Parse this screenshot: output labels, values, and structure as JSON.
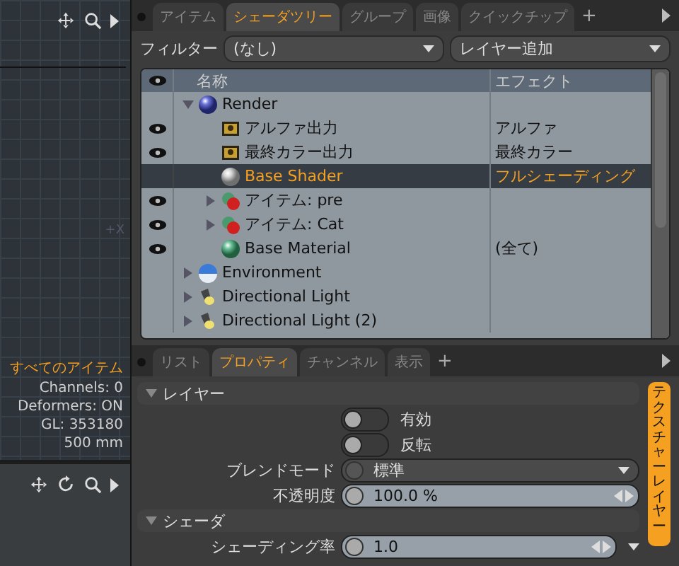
{
  "viewport_top": {
    "info": [
      {
        "text": "すべてのアイテム",
        "kind": "title"
      },
      {
        "text": "Channels: 0",
        "kind": "stat"
      },
      {
        "text": "Deformers: ON",
        "kind": "stat"
      },
      {
        "text": "GL: 353180",
        "kind": "stat"
      },
      {
        "text": "500 mm",
        "kind": "stat"
      }
    ],
    "axis_label": "+X"
  },
  "top_tab_add": "+",
  "bottom_tab_add": "+",
  "top_tabs": [
    {
      "label": "アイテム",
      "selected": false
    },
    {
      "label": "シェーダツリー",
      "selected": true
    },
    {
      "label": "グループ",
      "selected": false
    },
    {
      "label": "画像",
      "selected": false
    },
    {
      "label": "クイックチップ",
      "selected": false
    }
  ],
  "filter": {
    "label": "フィルター",
    "value": "(なし)",
    "add_layer": "レイヤー追加"
  },
  "tree": {
    "columns": [
      "名称",
      "エフェクト"
    ],
    "items": [
      {
        "name": "Render",
        "kind": "sphere-blue",
        "visible": false,
        "selected": false,
        "expanded": true,
        "children": [
          {
            "name": "アルファ出力",
            "kind": "image",
            "visible": true,
            "selected": false,
            "effect": "アルファ"
          },
          {
            "name": "最終カラー出力",
            "kind": "image",
            "visible": true,
            "selected": false,
            "effect": "最終カラー"
          },
          {
            "name": "Base Shader",
            "kind": "sphere-white",
            "visible": false,
            "selected": true,
            "effect": "フルシェーディング"
          },
          {
            "name": "アイテム: pre",
            "kind": "material-red",
            "visible": true,
            "selected": false,
            "expanded": false
          },
          {
            "name": "アイテム: Cat",
            "kind": "material-red",
            "visible": true,
            "selected": false,
            "expanded": false
          },
          {
            "name": "Base Material",
            "kind": "sphere-green",
            "visible": true,
            "selected": false,
            "effect": "(全て)"
          }
        ]
      },
      {
        "name": "Environment",
        "kind": "environment",
        "visible": false,
        "selected": false,
        "expanded": false
      },
      {
        "name": "Directional Light",
        "kind": "light",
        "visible": false,
        "selected": false,
        "expanded": false
      },
      {
        "name": "Directional Light (2)",
        "kind": "light",
        "visible": false,
        "selected": false,
        "expanded": false
      }
    ]
  },
  "bottom_tabs": [
    {
      "label": "リスト",
      "selected": false
    },
    {
      "label": "プロパティ",
      "selected": true
    },
    {
      "label": "チャンネル",
      "selected": false
    },
    {
      "label": "表示",
      "selected": false
    }
  ],
  "properties": [
    {
      "kind": "section",
      "label": "レイヤー"
    },
    {
      "kind": "toggle",
      "label": "有効",
      "on": false
    },
    {
      "kind": "toggle",
      "label": "反転",
      "on": false
    },
    {
      "kind": "dropdown",
      "label": "ブレンドモード",
      "value": "標準"
    },
    {
      "kind": "number",
      "label": "不透明度",
      "value": "100.0 %"
    },
    {
      "kind": "section",
      "label": "シェーダ"
    },
    {
      "kind": "number_menu",
      "label": "シェーディング率",
      "value": "1.0"
    }
  ],
  "side_tab": "テクスチャーレイヤー"
}
